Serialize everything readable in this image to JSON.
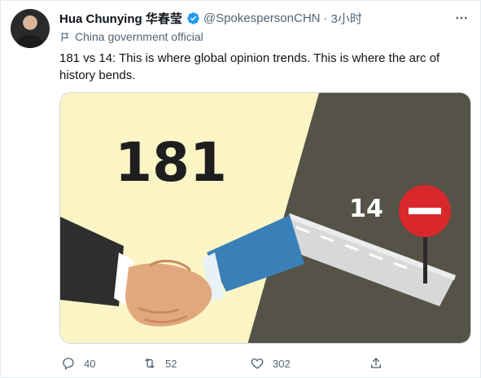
{
  "author": {
    "name": "Hua Chunying",
    "name_cjk": "华春莹",
    "handle": "@SpokespersonCHN",
    "time": "3小时",
    "label": "China government official"
  },
  "tweet": {
    "text": "181 vs 14: This is where global opinion trends. This is where the arc of history bends."
  },
  "media": {
    "big_number": "181",
    "small_number": "14",
    "colors": {
      "left_bg": "#fbf5c6",
      "right_bg": "#555247",
      "number": "#1e1e1e"
    }
  },
  "actions": {
    "reply_count": "40",
    "retweet_count": "52",
    "like_count": "302"
  },
  "colors": {
    "accent": "#1d9bf0",
    "muted": "#536471"
  }
}
